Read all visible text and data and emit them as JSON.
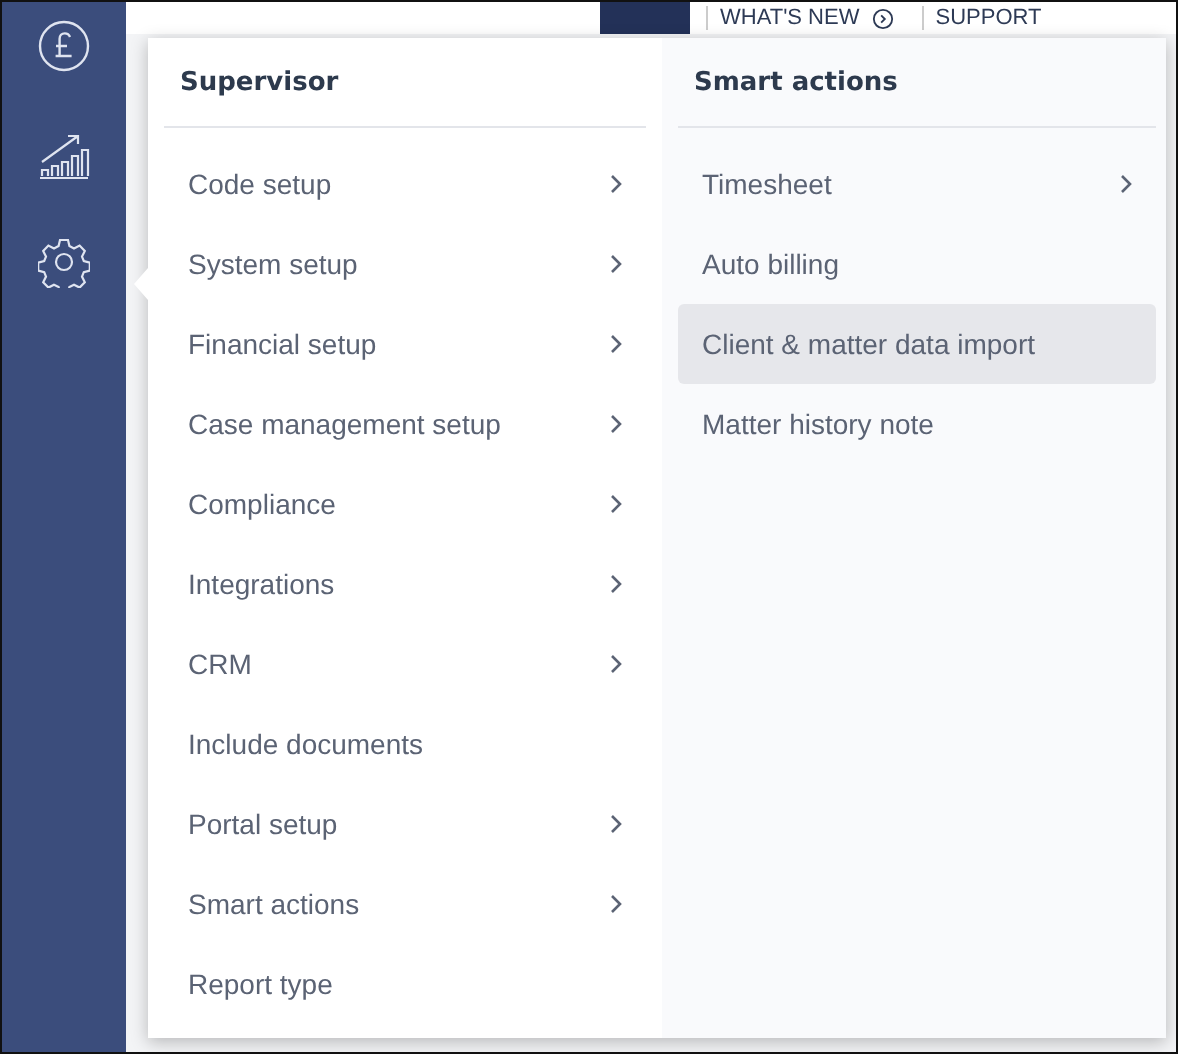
{
  "header_links": [
    {
      "label": "WHAT'S NEW",
      "kind": "info"
    },
    {
      "label": "SUPPORT",
      "kind": "plain"
    }
  ],
  "menu": {
    "columns": [
      {
        "title": "Supervisor",
        "items": [
          {
            "label": "Code setup",
            "has_submenu": true,
            "highlighted": false
          },
          {
            "label": "System setup",
            "has_submenu": true,
            "highlighted": false
          },
          {
            "label": "Financial setup",
            "has_submenu": true,
            "highlighted": false
          },
          {
            "label": "Case management setup",
            "has_submenu": true,
            "highlighted": false
          },
          {
            "label": "Compliance",
            "has_submenu": true,
            "highlighted": false
          },
          {
            "label": "Integrations",
            "has_submenu": true,
            "highlighted": false
          },
          {
            "label": "CRM",
            "has_submenu": true,
            "highlighted": false
          },
          {
            "label": "Include documents",
            "has_submenu": false,
            "highlighted": false
          },
          {
            "label": "Portal setup",
            "has_submenu": true,
            "highlighted": false
          },
          {
            "label": "Smart actions",
            "has_submenu": true,
            "highlighted": false
          },
          {
            "label": "Report type",
            "has_submenu": false,
            "highlighted": false
          }
        ]
      },
      {
        "title": "Smart actions",
        "items": [
          {
            "label": "Timesheet",
            "has_submenu": true,
            "highlighted": false
          },
          {
            "label": "Auto billing",
            "has_submenu": false,
            "highlighted": false
          },
          {
            "label": "Client & matter data import",
            "has_submenu": false,
            "highlighted": true
          },
          {
            "label": "Matter history note",
            "has_submenu": false,
            "highlighted": false
          }
        ]
      }
    ]
  }
}
